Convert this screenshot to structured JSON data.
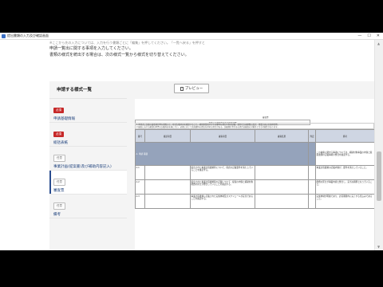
{
  "window": {
    "title": "提出書類の入力及び確認画面"
  },
  "intro": {
    "cut_line": "※ここから先の入力については、入力を行う書類ごとに「編集」を押してください。「一覧へ戻る」を押すと",
    "line1": "申請一覧出に関する事項を入力してください。",
    "line2": "書類の様式を統出する場合は、次の様式一覧から様式を切り替えてください。"
  },
  "sidebar": {
    "heading": "申請する様式一覧",
    "items": [
      {
        "badge": "必須",
        "label": "申請基礎情報",
        "required": true
      },
      {
        "badge": "必須",
        "label": "総括表紙",
        "required": true
      },
      {
        "badge": "任意",
        "label": "事業計画(提案書)及び補助内容記入)",
        "required": false
      },
      {
        "badge": "任意",
        "label": "審査票",
        "required": false
      },
      {
        "badge": "任意",
        "label": "備考",
        "required": false
      }
    ]
  },
  "preview": {
    "button_label": "プレビュー",
    "doc_title": "審査票",
    "doc_subtitle": "事業計画書類等審査項目確認票",
    "doc_note1": "1.本様式に記載の審査項目等を参照の上、様式記載内容を確認すること。補助事業者としての要件を満たす旨の記載、適切な計画期間の設定、事業計画の実施体制等。",
    "doc_note2": "2.審査における確認は本票の記載内容を基に行い、必要に応じて追加資料の提出を求める場合がある。記載漏れ等がある場合は審査の対象外となる可能性があります。",
    "table": {
      "headers": [
        "番号",
        "確認項目",
        "審査項目",
        "審査結果",
        "判定",
        "備考"
      ],
      "group_label": "A. 申請 基礎",
      "group_note": "この審査に関する事項については、補助対象事業の内容と提案書類の記載事項の整合を確認する。",
      "rows": [
        {
          "num": "A-1",
          "text": "提出された事業計画書類等について、様式の記載要件を満たしていることを確認する。",
          "remark": "事業計画書類の記載内容が、要件を満たしていること。"
        },
        {
          "num": "A-2",
          "text": "提出された事業計画書類等の記載について、提案の内容と補助対象経費の区分が整合していることを確認する。",
          "remark": "経費の区分が事業内容と整合し、妥当な積算となっていること。"
        },
        {
          "num": "A-3",
          "text": "事業計画書類に記載された実施体制及びスケジュールが妥当であることを確認する。",
          "remark": "実施体制が明確であり、計画期間内に完了する見込みであること。"
        }
      ]
    }
  },
  "colors": {
    "accent": "#2a4d8f",
    "required_badge": "#c62828",
    "table_header": "#cfd6e3",
    "table_group": "#95a3bb"
  }
}
